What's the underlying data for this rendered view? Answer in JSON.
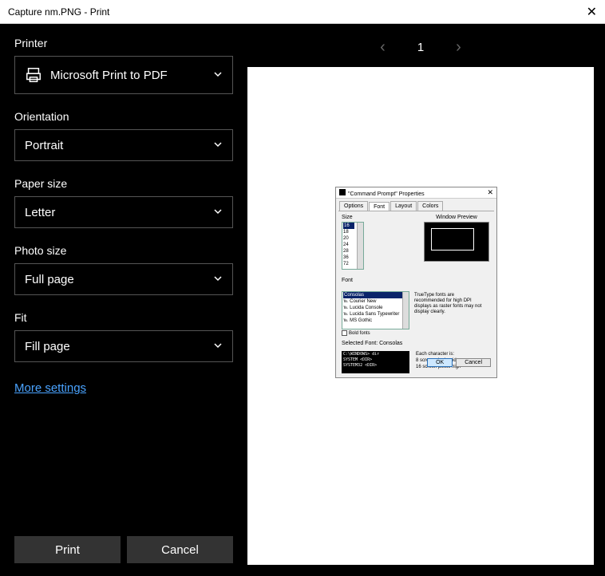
{
  "window": {
    "title": "Capture nm.PNG - Print",
    "close": "✕"
  },
  "panel": {
    "printer_label": "Printer",
    "printer_value": "Microsoft Print to PDF",
    "orientation_label": "Orientation",
    "orientation_value": "Portrait",
    "papersize_label": "Paper size",
    "papersize_value": "Letter",
    "photosize_label": "Photo size",
    "photosize_value": "Full page",
    "fit_label": "Fit",
    "fit_value": "Fill page",
    "more_settings": "More settings",
    "print_btn": "Print",
    "cancel_btn": "Cancel"
  },
  "nav": {
    "prev": "‹",
    "page": "1",
    "next": "›"
  },
  "preview_dialog": {
    "title": "\"Command Prompt\" Properties",
    "close": "✕",
    "tabs": [
      "Options",
      "Font",
      "Layout",
      "Colors"
    ],
    "active_tab": "Font",
    "size_label": "Size",
    "sizes": [
      "16",
      "18",
      "20",
      "24",
      "28",
      "36",
      "72"
    ],
    "size_selected": "16",
    "wp_label": "Window Preview",
    "font_label": "Font",
    "fonts": [
      "Consolas",
      "Courier New",
      "Lucida Console",
      "Lucida Sans Typewriter",
      "MS Gothic"
    ],
    "font_selected": "Consolas",
    "font_help": "TrueType fonts are recommended for high DPI displays as raster fonts may not display clearly.",
    "bold_label": "Bold fonts",
    "selected_label": "Selected Font: Consolas",
    "sample_lines": [
      "C:\\WINDOWS> dir",
      "SYSTEM       <DIR>",
      "SYSTEM32     <DIR>"
    ],
    "char_spec": "Each character is:\n8 screen pixels wide\n16 screen pixels high",
    "ok": "OK",
    "cancel": "Cancel"
  }
}
